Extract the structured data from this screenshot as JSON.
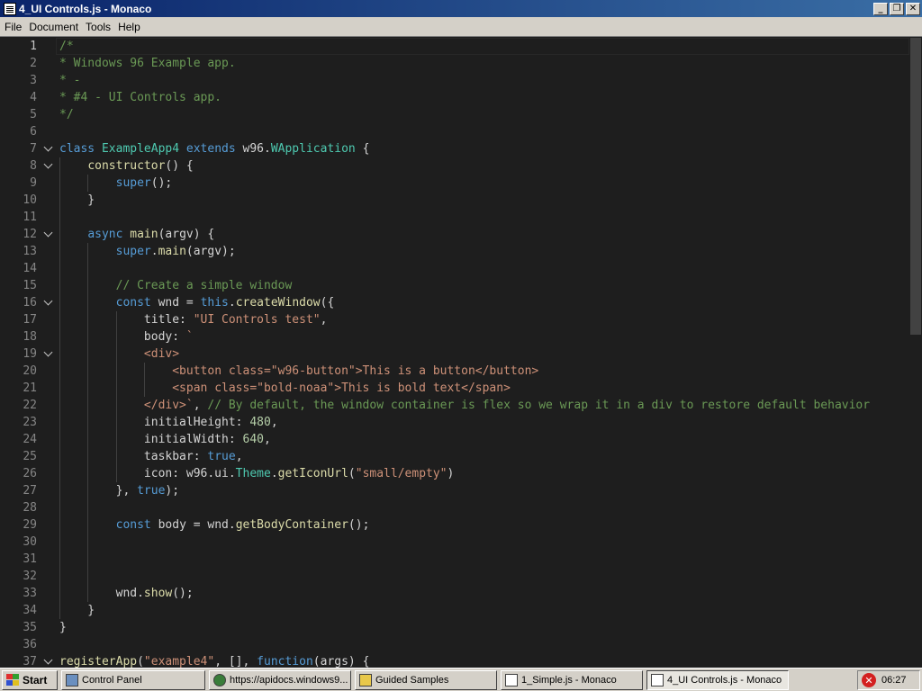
{
  "window": {
    "title": "4_UI Controls.js - Monaco",
    "min_glyph": "_",
    "max_glyph": "❐",
    "close_glyph": "✕"
  },
  "menu": [
    "File",
    "Document",
    "Tools",
    "Help"
  ],
  "editor": {
    "lines": [
      {
        "n": "1",
        "fold": false,
        "indent": 0,
        "tokens": [
          [
            "c-com",
            "/*"
          ]
        ]
      },
      {
        "n": "2",
        "fold": false,
        "indent": 0,
        "tokens": [
          [
            "c-com",
            "* Windows 96 Example app."
          ]
        ]
      },
      {
        "n": "3",
        "fold": false,
        "indent": 0,
        "tokens": [
          [
            "c-com",
            "* -"
          ]
        ]
      },
      {
        "n": "4",
        "fold": false,
        "indent": 0,
        "tokens": [
          [
            "c-com",
            "* #4 - UI Controls app."
          ]
        ]
      },
      {
        "n": "5",
        "fold": false,
        "indent": 0,
        "tokens": [
          [
            "c-com",
            "*/"
          ]
        ]
      },
      {
        "n": "6",
        "fold": false,
        "indent": 0,
        "tokens": []
      },
      {
        "n": "7",
        "fold": true,
        "indent": 0,
        "tokens": [
          [
            "c-kw",
            "class "
          ],
          [
            "c-cls",
            "ExampleApp4"
          ],
          [
            "c-pl",
            " "
          ],
          [
            "c-kw",
            "extends "
          ],
          [
            "c-pl",
            "w96."
          ],
          [
            "c-cls",
            "WApplication"
          ],
          [
            "c-pl",
            " {"
          ]
        ]
      },
      {
        "n": "8",
        "fold": true,
        "indent": 1,
        "tokens": [
          [
            "c-pl",
            "    "
          ],
          [
            "c-fn",
            "constructor"
          ],
          [
            "c-pl",
            "() {"
          ]
        ]
      },
      {
        "n": "9",
        "fold": false,
        "indent": 2,
        "tokens": [
          [
            "c-pl",
            "        "
          ],
          [
            "c-kw",
            "super"
          ],
          [
            "c-pl",
            "();"
          ]
        ]
      },
      {
        "n": "10",
        "fold": false,
        "indent": 1,
        "tokens": [
          [
            "c-pl",
            "    }"
          ]
        ]
      },
      {
        "n": "11",
        "fold": false,
        "indent": 1,
        "tokens": []
      },
      {
        "n": "12",
        "fold": true,
        "indent": 1,
        "tokens": [
          [
            "c-pl",
            "    "
          ],
          [
            "c-kw",
            "async "
          ],
          [
            "c-fn",
            "main"
          ],
          [
            "c-pl",
            "(argv) {"
          ]
        ]
      },
      {
        "n": "13",
        "fold": false,
        "indent": 2,
        "tokens": [
          [
            "c-pl",
            "        "
          ],
          [
            "c-kw",
            "super"
          ],
          [
            "c-pl",
            "."
          ],
          [
            "c-fn",
            "main"
          ],
          [
            "c-pl",
            "(argv);"
          ]
        ]
      },
      {
        "n": "14",
        "fold": false,
        "indent": 2,
        "tokens": []
      },
      {
        "n": "15",
        "fold": false,
        "indent": 2,
        "tokens": [
          [
            "c-pl",
            "        "
          ],
          [
            "c-com",
            "// Create a simple window"
          ]
        ]
      },
      {
        "n": "16",
        "fold": true,
        "indent": 2,
        "tokens": [
          [
            "c-pl",
            "        "
          ],
          [
            "c-kw",
            "const "
          ],
          [
            "c-pl",
            "wnd = "
          ],
          [
            "c-kw",
            "this"
          ],
          [
            "c-pl",
            "."
          ],
          [
            "c-fn",
            "createWindow"
          ],
          [
            "c-pl",
            "({"
          ]
        ]
      },
      {
        "n": "17",
        "fold": false,
        "indent": 3,
        "tokens": [
          [
            "c-pl",
            "            title: "
          ],
          [
            "c-str",
            "\"UI Controls test\""
          ],
          [
            "c-pl",
            ","
          ]
        ]
      },
      {
        "n": "18",
        "fold": false,
        "indent": 3,
        "tokens": [
          [
            "c-pl",
            "            body: "
          ],
          [
            "c-str",
            "`"
          ]
        ]
      },
      {
        "n": "19",
        "fold": true,
        "indent": 3,
        "tokens": [
          [
            "c-pl",
            "            "
          ],
          [
            "c-str",
            "<div>"
          ]
        ]
      },
      {
        "n": "20",
        "fold": false,
        "indent": 4,
        "tokens": [
          [
            "c-pl",
            "                "
          ],
          [
            "c-str",
            "<button class=\"w96-button\">This is a button</button>"
          ]
        ]
      },
      {
        "n": "21",
        "fold": false,
        "indent": 4,
        "tokens": [
          [
            "c-pl",
            "                "
          ],
          [
            "c-str",
            "<span class=\"bold-noaa\">This is bold text</span>"
          ]
        ]
      },
      {
        "n": "22",
        "fold": false,
        "indent": 3,
        "tokens": [
          [
            "c-pl",
            "            "
          ],
          [
            "c-str",
            "</div>`"
          ],
          [
            "c-pl",
            ", "
          ],
          [
            "c-com",
            "// By default, the window container is flex so we wrap it in a div to restore default behavior"
          ]
        ]
      },
      {
        "n": "23",
        "fold": false,
        "indent": 3,
        "tokens": [
          [
            "c-pl",
            "            initialHeight: "
          ],
          [
            "c-num",
            "480"
          ],
          [
            "c-pl",
            ","
          ]
        ]
      },
      {
        "n": "24",
        "fold": false,
        "indent": 3,
        "tokens": [
          [
            "c-pl",
            "            initialWidth: "
          ],
          [
            "c-num",
            "640"
          ],
          [
            "c-pl",
            ","
          ]
        ]
      },
      {
        "n": "25",
        "fold": false,
        "indent": 3,
        "tokens": [
          [
            "c-pl",
            "            taskbar: "
          ],
          [
            "c-kw",
            "true"
          ],
          [
            "c-pl",
            ","
          ]
        ]
      },
      {
        "n": "26",
        "fold": false,
        "indent": 3,
        "tokens": [
          [
            "c-pl",
            "            icon: w96.ui."
          ],
          [
            "c-cls",
            "Theme"
          ],
          [
            "c-pl",
            "."
          ],
          [
            "c-fn",
            "getIconUrl"
          ],
          [
            "c-pl",
            "("
          ],
          [
            "c-str",
            "\"small/empty\""
          ],
          [
            "c-pl",
            ")"
          ]
        ]
      },
      {
        "n": "27",
        "fold": false,
        "indent": 2,
        "tokens": [
          [
            "c-pl",
            "        }, "
          ],
          [
            "c-kw",
            "true"
          ],
          [
            "c-pl",
            ");"
          ]
        ]
      },
      {
        "n": "28",
        "fold": false,
        "indent": 2,
        "tokens": []
      },
      {
        "n": "29",
        "fold": false,
        "indent": 2,
        "tokens": [
          [
            "c-pl",
            "        "
          ],
          [
            "c-kw",
            "const "
          ],
          [
            "c-pl",
            "body = wnd."
          ],
          [
            "c-fn",
            "getBodyContainer"
          ],
          [
            "c-pl",
            "();"
          ]
        ]
      },
      {
        "n": "30",
        "fold": false,
        "indent": 2,
        "tokens": []
      },
      {
        "n": "31",
        "fold": false,
        "indent": 2,
        "tokens": []
      },
      {
        "n": "32",
        "fold": false,
        "indent": 2,
        "tokens": []
      },
      {
        "n": "33",
        "fold": false,
        "indent": 2,
        "tokens": [
          [
            "c-pl",
            "        wnd."
          ],
          [
            "c-fn",
            "show"
          ],
          [
            "c-pl",
            "();"
          ]
        ]
      },
      {
        "n": "34",
        "fold": false,
        "indent": 1,
        "tokens": [
          [
            "c-pl",
            "    }"
          ]
        ]
      },
      {
        "n": "35",
        "fold": false,
        "indent": 0,
        "tokens": [
          [
            "c-pl",
            "}"
          ]
        ]
      },
      {
        "n": "36",
        "fold": false,
        "indent": 0,
        "tokens": []
      },
      {
        "n": "37",
        "fold": true,
        "indent": 0,
        "tokens": [
          [
            "c-fn",
            "registerApp"
          ],
          [
            "c-pl",
            "("
          ],
          [
            "c-str",
            "\"example4\""
          ],
          [
            "c-pl",
            ", [], "
          ],
          [
            "c-kw",
            "function"
          ],
          [
            "c-pl",
            "(args) {"
          ]
        ]
      }
    ]
  },
  "taskbar": {
    "start_label": "Start",
    "tasks": [
      {
        "label": "Control Panel",
        "icon": "control-panel-icon",
        "active": false
      },
      {
        "label": "https://apidocs.windows9...",
        "icon": "globe-icon",
        "active": false
      },
      {
        "label": "Guided Samples",
        "icon": "folder-icon",
        "active": false
      },
      {
        "label": "1_Simple.js - Monaco",
        "icon": "document-icon",
        "active": false
      },
      {
        "label": "4_UI Controls.js - Monaco",
        "icon": "document-icon",
        "active": true
      }
    ],
    "tray_error_glyph": "✕",
    "clock": "06:27"
  },
  "colors": {
    "titlebar_start": "#0a246a",
    "titlebar_end": "#3a6ea5",
    "editor_bg": "#1e1e1e",
    "chrome": "#d4d0c8"
  }
}
